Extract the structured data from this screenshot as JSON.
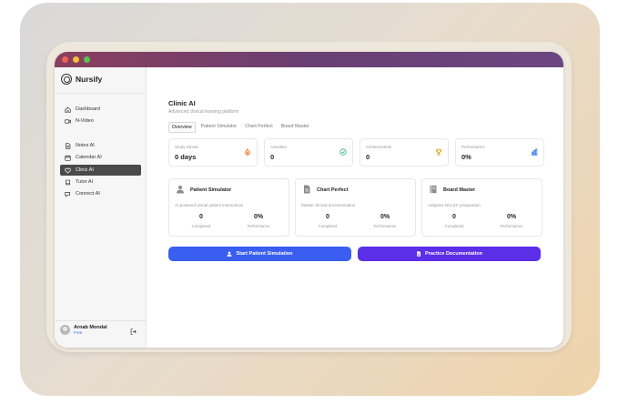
{
  "app": {
    "name": "Nursify"
  },
  "sidebar": {
    "items": [
      {
        "label": "Dashboard",
        "icon": "home-icon"
      },
      {
        "label": "N-Video",
        "icon": "video-icon"
      },
      {
        "label": "Notes AI",
        "icon": "document-icon"
      },
      {
        "label": "Calendar AI",
        "icon": "calendar-icon"
      },
      {
        "label": "Clinic AI",
        "icon": "heart-icon",
        "active": true
      },
      {
        "label": "Tutor AI",
        "icon": "book-icon"
      },
      {
        "label": "Connect AI",
        "icon": "chat-icon"
      }
    ]
  },
  "user": {
    "name": "Arnab Mondal",
    "plan": "Free"
  },
  "page": {
    "title": "Clinic AI",
    "subtitle": "Advanced clinical learning platform"
  },
  "tabs": [
    "Overview",
    "Patient Simulator",
    "Chart Perfect",
    "Board Master"
  ],
  "stats": [
    {
      "label": "Study Streak",
      "value": "0 days",
      "icon": "flame-icon",
      "color": "#f07a2a"
    },
    {
      "label": "Activities",
      "value": "0",
      "icon": "check-circle-icon",
      "color": "#2bb673"
    },
    {
      "label": "Achievements",
      "value": "0",
      "icon": "trophy-icon",
      "color": "#e0a80f"
    },
    {
      "label": "Performance",
      "value": "0%",
      "icon": "bar-chart-icon",
      "color": "#3a7bf0"
    }
  ],
  "cards": [
    {
      "title": "Patient Simulator",
      "desc": "AI-powered virtual patient interactions",
      "completed": "0",
      "completed_label": "Completed",
      "performance": "0%",
      "performance_label": "Performance",
      "icon": "user-icon"
    },
    {
      "title": "Chart Perfect",
      "desc": "Master clinical documentation",
      "completed": "0",
      "completed_label": "Completed",
      "performance": "0%",
      "performance_label": "Performance",
      "icon": "file-icon"
    },
    {
      "title": "Board Master",
      "desc": "Adaptive NCLEX preparation",
      "completed": "0",
      "completed_label": "Completed",
      "performance": "0%",
      "performance_label": "Performance",
      "icon": "book-icon"
    }
  ],
  "actions": {
    "start_simulation": "Start Patient Simulation",
    "practice_documentation": "Practice Documentation"
  },
  "colors": {
    "primary_blue": "#3a5ef0",
    "primary_purple": "#5b2ee8",
    "titlebar": "#6a3f73"
  }
}
